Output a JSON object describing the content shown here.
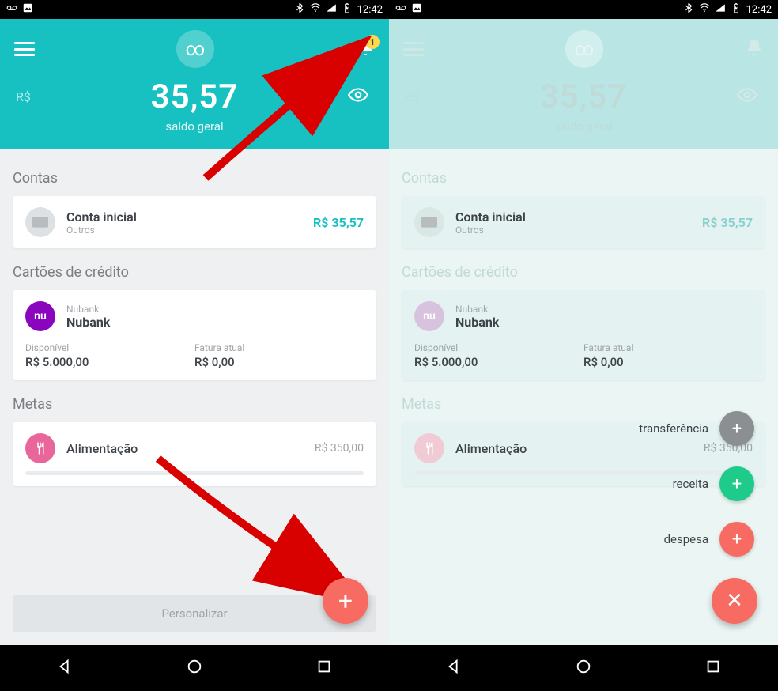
{
  "status": {
    "time": "12:42"
  },
  "header": {
    "currency": "R$",
    "balance": "35,57",
    "balance_label": "saldo geral",
    "notification_count": "1"
  },
  "sections": {
    "accounts_title": "Contas",
    "credit_title": "Cartões de crédito",
    "goals_title": "Metas"
  },
  "account": {
    "name": "Conta inicial",
    "subtitle": "Outros",
    "balance": "R$ 35,57"
  },
  "credit": {
    "provider": "Nubank",
    "name": "Nubank",
    "available_label": "Disponível",
    "available_value": "R$ 5.000,00",
    "invoice_label": "Fatura atual",
    "invoice_value": "R$ 0,00"
  },
  "goal": {
    "name": "Alimentação",
    "amount": "R$ 350,00"
  },
  "personalize_label": "Personalizar",
  "speed_dial": {
    "transfer": "transferência",
    "income": "receita",
    "expense": "despesa"
  }
}
